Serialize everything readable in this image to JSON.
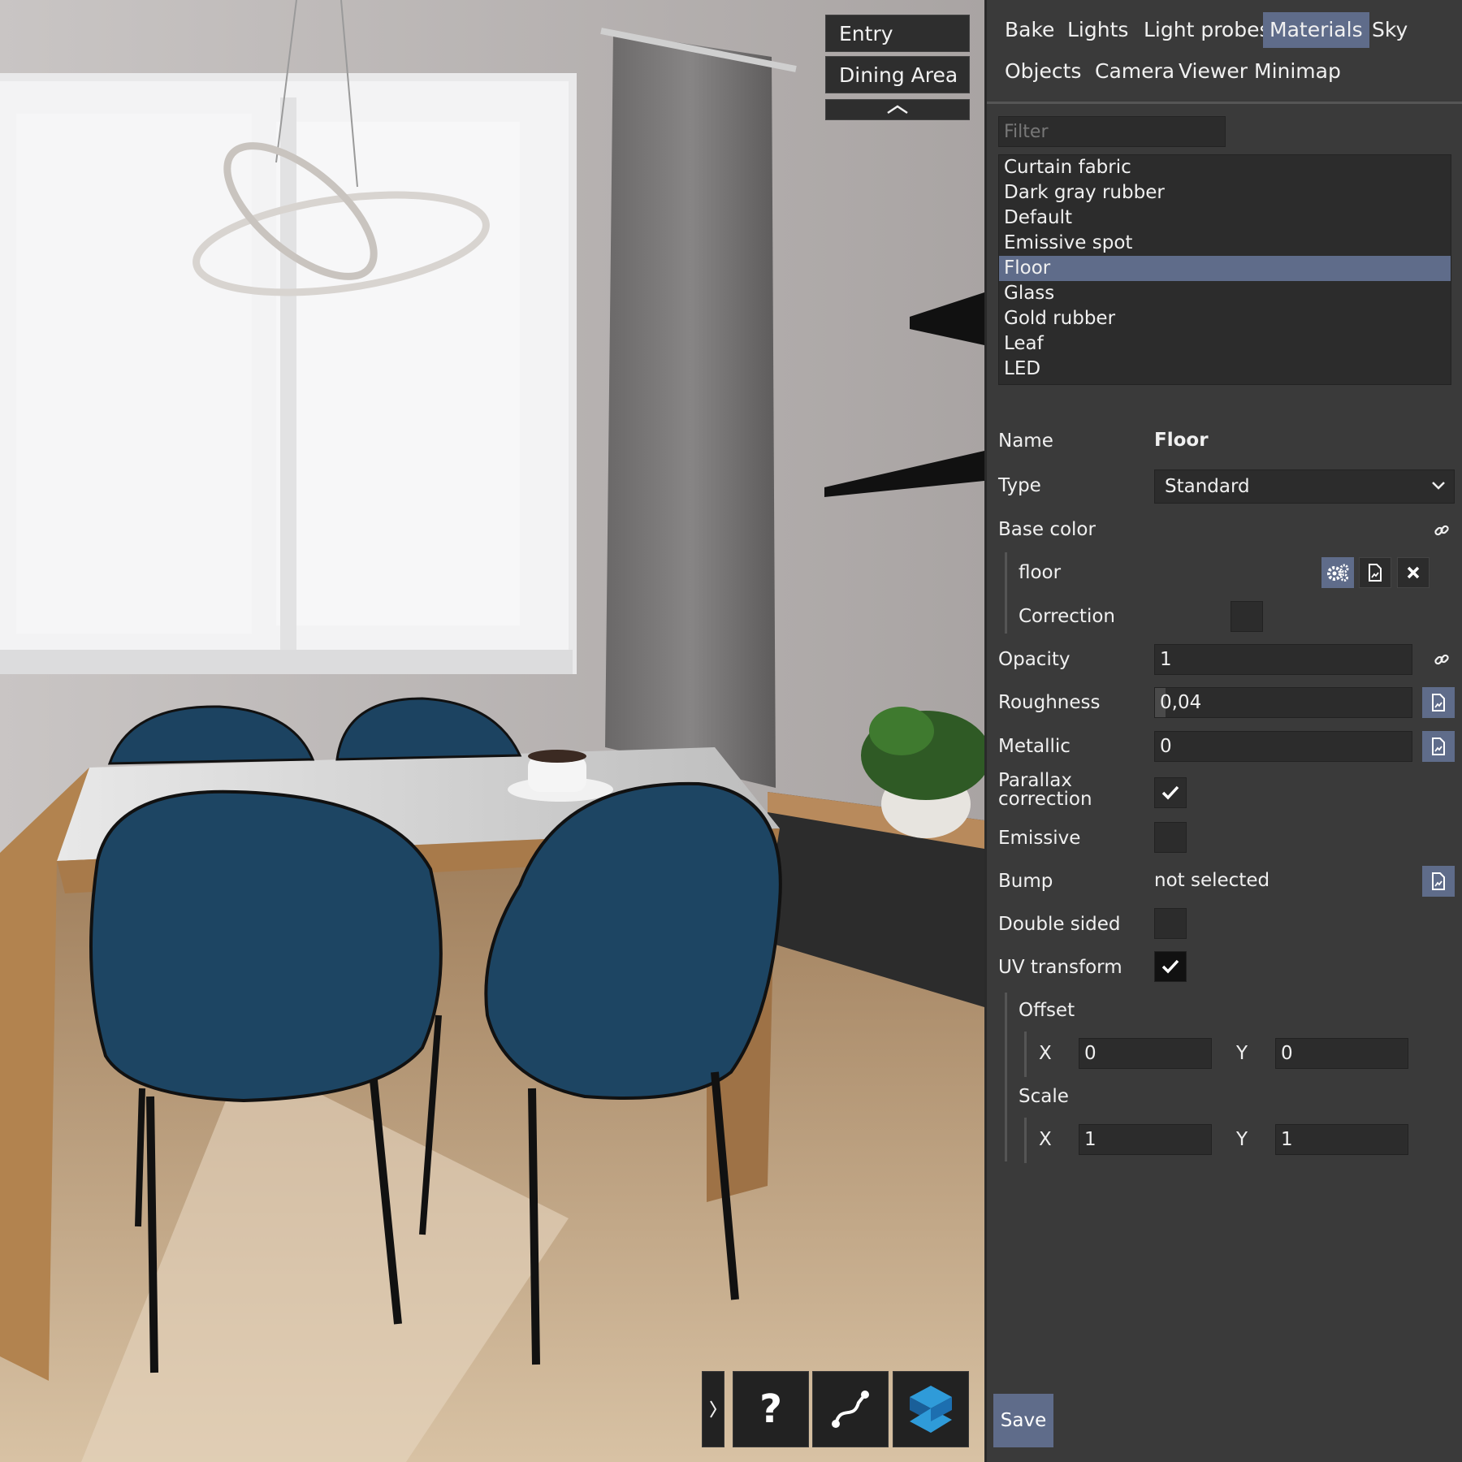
{
  "viewport": {
    "cameras": [
      {
        "label": "Entry"
      },
      {
        "label": "Dining Area"
      }
    ],
    "help_glyph": "?"
  },
  "tabs": [
    {
      "label": "Bake"
    },
    {
      "label": "Lights"
    },
    {
      "label": "Light probes"
    },
    {
      "label": "Materials"
    },
    {
      "label": "Sky"
    },
    {
      "label": "Objects"
    },
    {
      "label": "Camera"
    },
    {
      "label": "Viewer"
    },
    {
      "label": "Minimap"
    }
  ],
  "active_tab": "Materials",
  "filter": {
    "placeholder": "Filter",
    "value": ""
  },
  "materials": [
    "Curtain fabric",
    "Dark gray rubber",
    "Default",
    "Emissive spot",
    "Floor",
    "Glass",
    "Gold rubber",
    "Leaf",
    "LED"
  ],
  "selected_material": "Floor",
  "props": {
    "name_label": "Name",
    "name_value": "Floor",
    "type_label": "Type",
    "type_value": "Standard",
    "base_color_label": "Base color",
    "texture_name": "floor",
    "correction_label": "Correction",
    "opacity_label": "Opacity",
    "opacity_value": "1",
    "roughness_label": "Roughness",
    "roughness_value": "0,04",
    "roughness_fraction": 0.04,
    "metallic_label": "Metallic",
    "metallic_value": "0",
    "parallax_label_1": "Parallax",
    "parallax_label_2": "correction",
    "parallax_checked": true,
    "emissive_label": "Emissive",
    "emissive_checked": false,
    "bump_label": "Bump",
    "bump_value": "not selected",
    "double_sided_label": "Double sided",
    "double_sided_checked": false,
    "uv_label": "UV transform",
    "uv_checked": true,
    "offset_label": "Offset",
    "offset_x_label": "X",
    "offset_x": "0",
    "offset_y_label": "Y",
    "offset_y": "0",
    "scale_label": "Scale",
    "scale_x_label": "X",
    "scale_x": "1",
    "scale_y_label": "Y",
    "scale_y": "1"
  },
  "save_label": "Save",
  "colors": {
    "accent": "#5f6c8a",
    "panel": "#3a3a3a",
    "field": "#2c2c2c",
    "chair": "#1d4563"
  }
}
